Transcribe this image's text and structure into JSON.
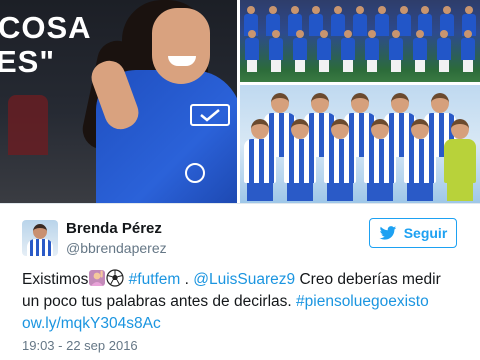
{
  "media": {
    "caption_line1": "COSA",
    "caption_line2": "ES\""
  },
  "tweet": {
    "author": {
      "display_name": "Brenda Pérez",
      "screen_name": "@bbrendaperez"
    },
    "follow_button": {
      "label": "Seguir",
      "icon": "twitter-bird-icon"
    },
    "text": {
      "word1": "Existimos",
      "emoji1": "woman-raising-hand-emoji",
      "emoji2": "soccer-ball-emoji",
      "hashtag1": "#futfem",
      "sep1": " . ",
      "mention1": "@LuisSuarez9",
      "after_mention": " Creo deberías medir",
      "line2_text": "un poco tus palabras antes de decirlas. ",
      "hashtag2": "#piensoluegoexisto",
      "link": "ow.ly/mqkY304s8Ac"
    },
    "timestamp": "19:03 - 22 sep 2016"
  },
  "colors": {
    "link": "#1b95e0",
    "follow_accent": "#1da1f2",
    "secondary_text": "#657786"
  }
}
